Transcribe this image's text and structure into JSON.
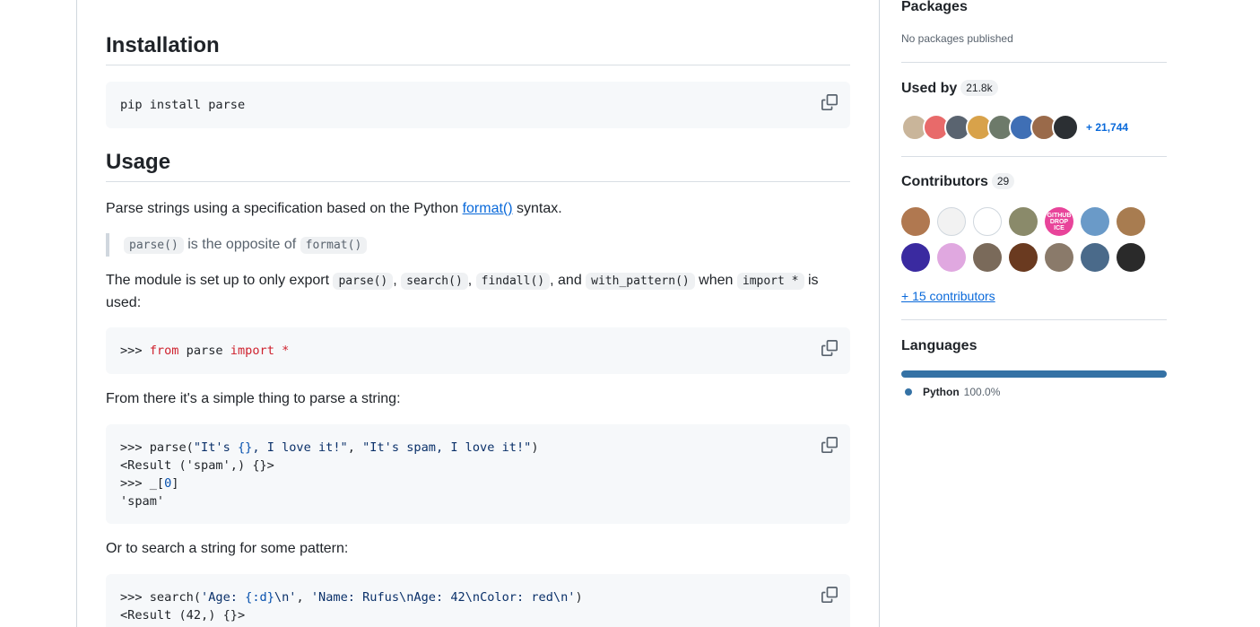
{
  "readme": {
    "installation": {
      "heading": "Installation",
      "code": "pip install parse"
    },
    "usage": {
      "heading": "Usage",
      "intro_before": "Parse strings using a specification based on the Python ",
      "intro_link": "format()",
      "intro_after": " syntax.",
      "quote_code_1": "parse()",
      "quote_text": " is the opposite of ",
      "quote_code_2": "format()",
      "module_text_1": "The module is set up to only export ",
      "module_code_1": "parse()",
      "module_sep_1": ", ",
      "module_code_2": "search()",
      "module_sep_2": ", ",
      "module_code_3": "findall()",
      "module_sep_3": ", and ",
      "module_code_4": "with_pattern()",
      "module_text_2": " when ",
      "module_code_5": "import *",
      "module_text_3": " is used:",
      "code_import": {
        "prompt": ">>> ",
        "kw1": "from",
        "mid": " parse ",
        "kw2": "import",
        "star": " *"
      },
      "from_there": "From there it's a simple thing to parse a string:",
      "code_parse": {
        "l1_prompt": ">>> parse(",
        "l1_s1": "\"It's ",
        "l1_brace": "{}",
        "l1_s1b": ", I love it!\"",
        "l1_sep": ", ",
        "l1_s2": "\"It's spam, I love it!\"",
        "l1_close": ")",
        "l2": "<Result ('spam',) {}>",
        "l3_a": ">>> _[",
        "l3_num": "0",
        "l3_b": "]",
        "l4": "'spam'"
      },
      "search_text": "Or to search a string for some pattern:",
      "code_search": {
        "l1_prompt": ">>> search(",
        "l1_s1a": "'Age: ",
        "l1_fmt": "{:d}",
        "l1_s1b": "\\n'",
        "l1_sep": ", ",
        "l1_s2": "'Name: Rufus\\nAge: 42\\nColor: red\\n'",
        "l1_close": ")",
        "l2": "<Result (42,) {}>"
      }
    }
  },
  "sidebar": {
    "packages": {
      "heading": "Packages",
      "empty": "No packages published"
    },
    "used_by": {
      "heading": "Used by",
      "count": "21.8k",
      "more": "+ 21,744",
      "avatar_colors": [
        "#c9b59a",
        "#e86a6a",
        "#5a6470",
        "#d8a24a",
        "#6d7a6a",
        "#3f6fb5",
        "#9a6a4a",
        "#2b2f33"
      ]
    },
    "contributors": {
      "heading": "Contributors",
      "count": "29",
      "more": "+ 15 contributors",
      "avatars": [
        {
          "name": "contributor-1",
          "color": "#b07850",
          "label": ""
        },
        {
          "name": "contributor-2",
          "color": "#f2f2f2",
          "label": ""
        },
        {
          "name": "contributor-3",
          "color": "#ffffff",
          "label": ""
        },
        {
          "name": "contributor-4",
          "color": "#8a8a6a",
          "label": ""
        },
        {
          "name": "contributor-5",
          "color": "#e8449a",
          "label": "GITHUB DROP ICE"
        },
        {
          "name": "contributor-6",
          "color": "#6a9ac8",
          "label": ""
        },
        {
          "name": "contributor-7",
          "color": "#a87c50",
          "label": ""
        },
        {
          "name": "contributor-8",
          "color": "#3a2aa0",
          "label": ""
        },
        {
          "name": "contributor-9",
          "color": "#e0a8e0",
          "label": ""
        },
        {
          "name": "contributor-10",
          "color": "#7a6a5a",
          "label": ""
        },
        {
          "name": "contributor-11",
          "color": "#6a3a20",
          "label": ""
        },
        {
          "name": "contributor-12",
          "color": "#8a7a6a",
          "label": ""
        },
        {
          "name": "contributor-13",
          "color": "#4a6a8a",
          "label": ""
        },
        {
          "name": "contributor-14",
          "color": "#2a2a2a",
          "label": ""
        }
      ]
    },
    "languages": {
      "heading": "Languages",
      "items": [
        {
          "name": "Python",
          "percent": "100.0%",
          "fraction": 1.0,
          "color": "#3572A5"
        }
      ]
    }
  }
}
